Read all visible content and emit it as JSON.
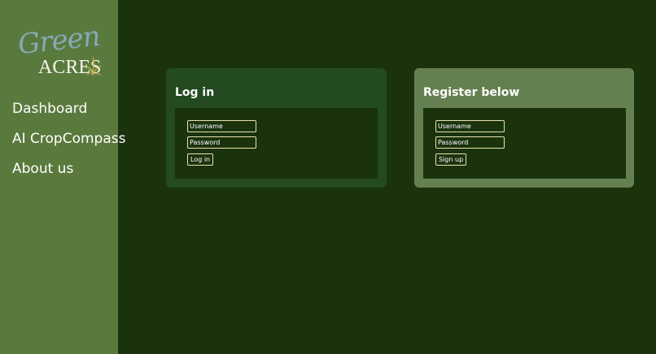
{
  "brand": {
    "logo_script": "Green",
    "logo_caps": "ACRES",
    "colors": {
      "script": "#86a9b6",
      "leaf": "#c9b24a"
    }
  },
  "nav": {
    "items": [
      {
        "label": "Dashboard"
      },
      {
        "label": "AI CropCompass"
      },
      {
        "label": "About us"
      }
    ]
  },
  "login": {
    "title": "Log in",
    "username_placeholder": "Username",
    "password_placeholder": "Password",
    "submit_label": "Log in"
  },
  "register": {
    "title": "Register below",
    "username_placeholder": "Username",
    "password_placeholder": "Password",
    "submit_label": "Sign up"
  },
  "colors": {
    "background": "#1a330d",
    "sidebar": "#5a7a3d",
    "login_card": "#234a20",
    "register_card": "#658050",
    "field_border": "#e8e2b0"
  }
}
